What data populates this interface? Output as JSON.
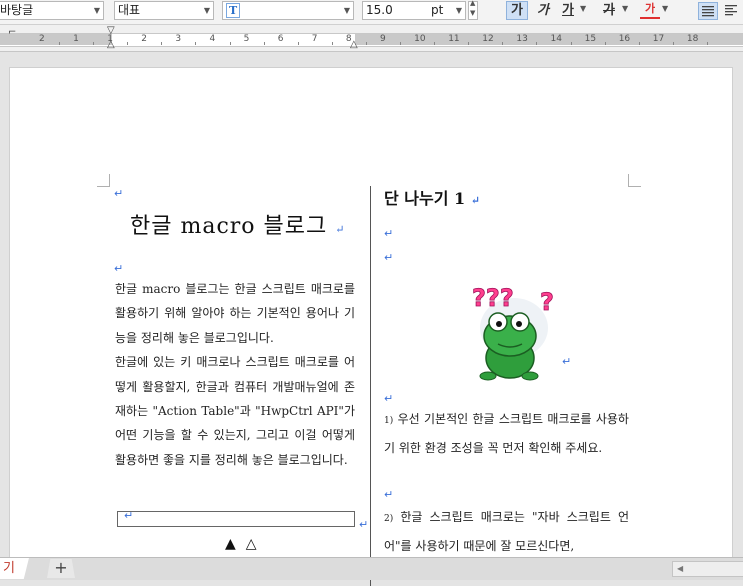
{
  "toolbar": {
    "font_lang": "바탕글",
    "style": "대표",
    "font_icon": "T",
    "size_value": "15.0",
    "size_unit": "pt",
    "bold_label": "가",
    "italic_label": "가",
    "underline_label": "가",
    "strike_label": "가",
    "color_label": "가",
    "icons": [
      "font-type-icon",
      "bold-icon",
      "italic-icon",
      "underline-icon",
      "strike-icon",
      "font-color-icon",
      "align-justify-icon",
      "align-left-icon"
    ]
  },
  "ruler": {
    "numbers": [
      "2",
      "1",
      "1",
      "2",
      "3",
      "4",
      "5",
      "6",
      "7",
      "8",
      "9",
      "10",
      "11",
      "12",
      "13",
      "14",
      "15",
      "16",
      "17",
      "18"
    ]
  },
  "document": {
    "left_title": "한글 macro 블로그",
    "left_paragraphs": [
      "한글 macro 블로그는 한글 스크립트 매크로를 활용하기 위해 알아야 하는 기본적인 용어나 기능을 정리해 놓은 블로그입니다.",
      "한글에 있는 키 매크로나 스크립트 매크로를 어떻게 활용할지, 한글과 컴퓨터 개발매뉴얼에 존재하는 \"Action Table\"과 \"HwpCtrl API\"가 어떤 기능을 할 수 있는지, 그리고 이걸 어떻게 활용하면 좋을 지를 정리해 놓은 블로그입니다."
    ],
    "right_title": "단 나누기 1",
    "right_fn1_num": "1)",
    "right_fn1_text": "우선 기본적인 한글 스크립트 매크로를 사용하기 위한 환경 조성을 꼭 먼저 확인해 주세요.",
    "right_fn2_num": "2)",
    "right_fn2_text": "한글 스크립트 매크로는 \"자바 스크립트 언어\"를 사용하기 때문에 잘 모르신다면,",
    "return_mark": "↵",
    "frog_marks": "???"
  },
  "tabbar": {
    "sheet_tab": "기",
    "add_label": "+"
  },
  "colors": {
    "return_mark": "#3a6fd8",
    "active_button": "#cfe0f5",
    "font_color_underline": "#e03030",
    "sheet_tab_text": "#c0392b"
  }
}
